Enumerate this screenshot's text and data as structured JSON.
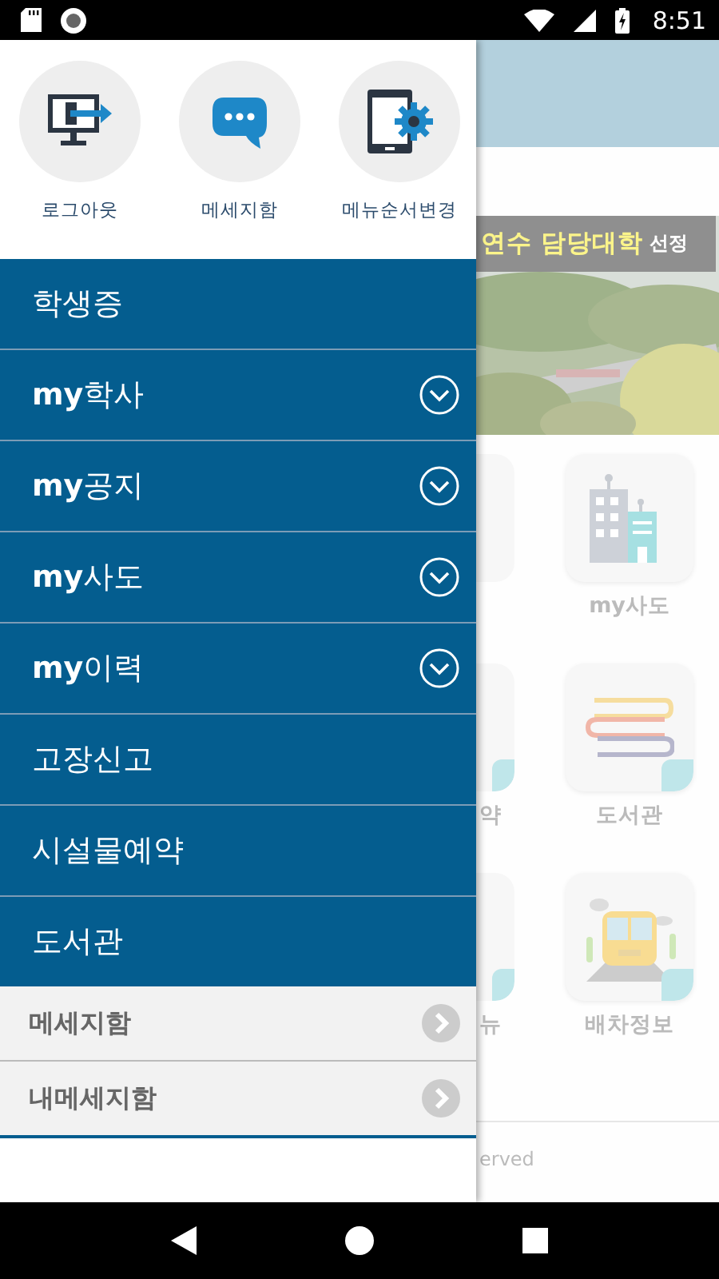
{
  "status_bar": {
    "time": "8:51"
  },
  "drawer": {
    "shortcuts": [
      {
        "label": "로그아웃",
        "kind": "logout"
      },
      {
        "label": "메세지함",
        "kind": "message"
      },
      {
        "label": "메뉴순서변경",
        "kind": "reorder"
      }
    ],
    "menu": [
      {
        "label": "학생증",
        "kind": "link"
      },
      {
        "label": "**my**학사",
        "kind": "group",
        "expanded": false
      },
      {
        "label": "**my**공지",
        "kind": "group",
        "expanded": false
      },
      {
        "label": "**my**사도",
        "kind": "group",
        "expanded": false
      },
      {
        "label": "**my**이력",
        "kind": "group",
        "expanded": false
      },
      {
        "label": "고장신고",
        "kind": "link"
      },
      {
        "label": "시설물예약",
        "kind": "link"
      },
      {
        "label": "도서관",
        "kind": "link"
      }
    ],
    "sub_links": [
      {
        "label": "메세지함"
      },
      {
        "label": "내메세지함"
      }
    ]
  },
  "background": {
    "banner": {
      "highlight": "연수 담당대학",
      "text": "선정"
    },
    "partial_tiles": [
      {
        "badge": false
      },
      {
        "badge": true,
        "label": "약"
      },
      {
        "badge": true,
        "label": "뉴"
      }
    ],
    "tiles": [
      {
        "label": "my사도",
        "kind": "building",
        "badge": false
      },
      {
        "label": "도서관",
        "kind": "books",
        "badge": true
      },
      {
        "label": "배차정보",
        "kind": "bus",
        "badge": true
      }
    ],
    "footer": "erved"
  }
}
